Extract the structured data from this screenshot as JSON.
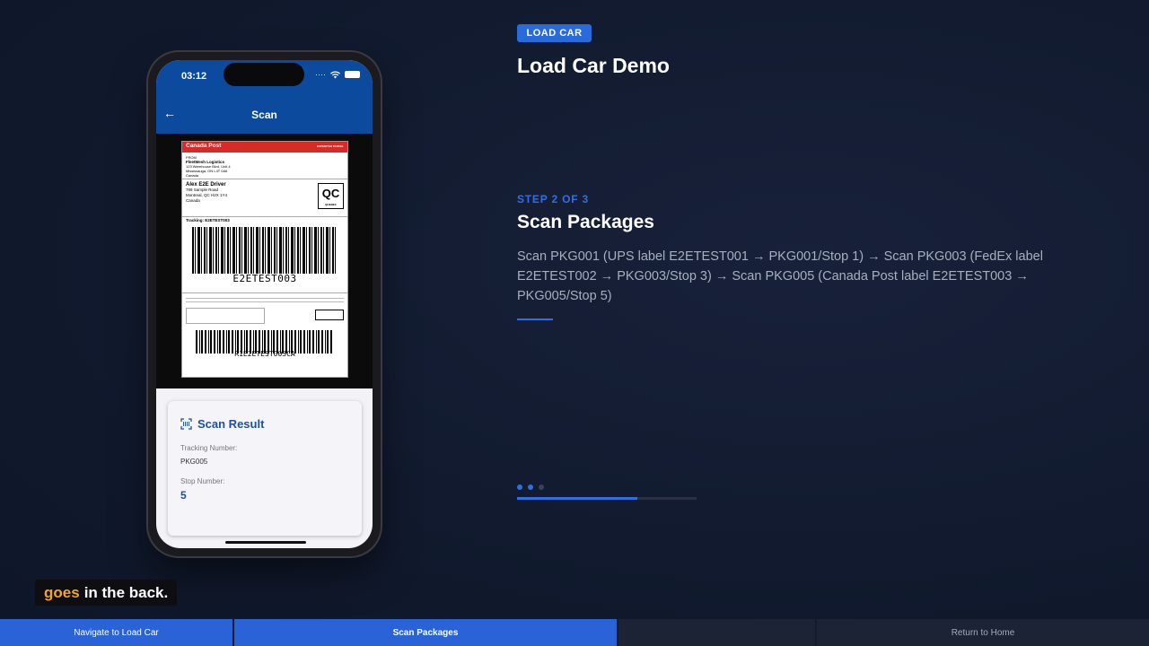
{
  "phone": {
    "time": "03:12",
    "nav_title": "Scan",
    "label": {
      "carrier": "Canada Post",
      "carrier_small": "EXPEDITED PARCEL",
      "from_label": "FROM",
      "from_name": "FleetMesh Logistics",
      "from_addr1": "123 Warehouse Blvd, Unit 4",
      "from_addr2": "Mississauga, ON L4T 0A6",
      "from_addr3": "Canada",
      "to_name": "Alex E2E Driver",
      "to_addr1": "789 Sample Road",
      "to_addr2": "Montreal, QC H2X 1Y4",
      "to_addr3": "Canada",
      "province": "QC",
      "province_small": "QUEBEC",
      "tracking_line": "Tracking: E2ETEST003",
      "barcode_text": "E2ETEST003",
      "barcode2_text": "R1E2ETEST003CA"
    },
    "result": {
      "title": "Scan Result",
      "tracking_label": "Tracking Number:",
      "tracking_value": "PKG005",
      "stop_label": "Stop Number:",
      "stop_value": "5"
    }
  },
  "panel": {
    "badge": "LOAD CAR",
    "title": "Load Car Demo",
    "step": "STEP 2 OF 3",
    "step_title": "Scan Packages",
    "description": "Scan PKG001 (UPS label E2ETEST001 → PKG001/Stop 1) → Scan PKG003 (FedEx label E2ETEST002 → PKG003/Stop 3) → Scan PKG005 (Canada Post label E2ETEST003 → PKG005/Stop 5)",
    "progress": 0.67,
    "current_step": 2,
    "total_steps": 3,
    "accent": "#2f6fe6"
  },
  "caption": {
    "highlight": "goes",
    "rest": "in the back."
  },
  "bottom_nav": {
    "item1": "Navigate to Load Car",
    "item2": "Scan Packages",
    "item3": "",
    "item4": "Return to Home"
  }
}
